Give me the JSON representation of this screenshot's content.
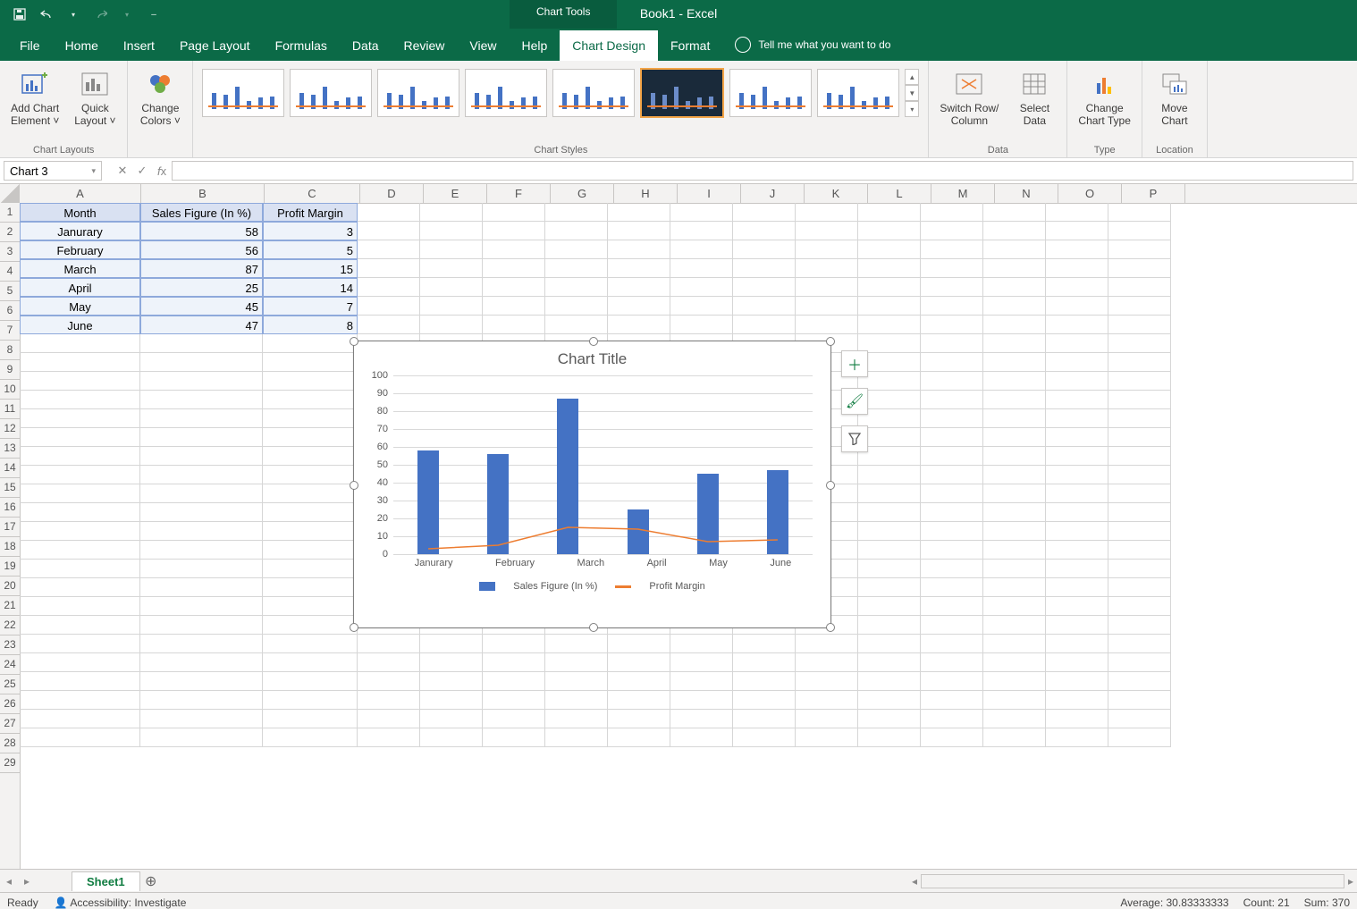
{
  "titlebar": {
    "doc": "Book1  -  Excel",
    "contextual": "Chart Tools"
  },
  "tabs": [
    "File",
    "Home",
    "Insert",
    "Page Layout",
    "Formulas",
    "Data",
    "Review",
    "View",
    "Help",
    "Chart Design",
    "Format"
  ],
  "active_tab": "Chart Design",
  "tellme": "Tell me what you want to do",
  "ribbon": {
    "chart_layouts": {
      "label": "Chart Layouts",
      "add": "Add Chart\nElement ˅",
      "quick": "Quick\nLayout ˅"
    },
    "colors": {
      "label": "",
      "btn": "Change\nColors ˅"
    },
    "styles": {
      "label": "Chart Styles"
    },
    "data": {
      "label": "Data",
      "switch": "Switch Row/\nColumn",
      "select": "Select\nData"
    },
    "type": {
      "label": "Type",
      "change": "Change\nChart Type"
    },
    "location": {
      "label": "Location",
      "move": "Move\nChart"
    }
  },
  "namebox": "Chart 3",
  "columns": [
    "A",
    "B",
    "C",
    "D",
    "E",
    "F",
    "G",
    "H",
    "I",
    "J",
    "K",
    "L",
    "M",
    "N",
    "O",
    "P"
  ],
  "headers": {
    "A": "Month",
    "B": "Sales Figure (In %)",
    "C": "Profit Margin"
  },
  "rows": [
    {
      "A": "Janurary",
      "B": 58,
      "C": 3
    },
    {
      "A": "February",
      "B": 56,
      "C": 5
    },
    {
      "A": "March",
      "B": 87,
      "C": 15
    },
    {
      "A": "April",
      "B": 25,
      "C": 14
    },
    {
      "A": "May",
      "B": 45,
      "C": 7
    },
    {
      "A": "June",
      "B": 47,
      "C": 8
    }
  ],
  "chart_data": {
    "type": "combo",
    "title": "Chart Title",
    "categories": [
      "Janurary",
      "February",
      "March",
      "April",
      "May",
      "June"
    ],
    "series": [
      {
        "name": "Sales Figure (In %)",
        "type": "bar",
        "values": [
          58,
          56,
          87,
          25,
          45,
          47
        ],
        "color": "#4472c4"
      },
      {
        "name": "Profit Margin",
        "type": "line",
        "values": [
          3,
          5,
          15,
          14,
          7,
          8
        ],
        "color": "#ed7d31"
      }
    ],
    "ylim": [
      0,
      100
    ],
    "ystep": 10,
    "xlabel": "",
    "ylabel": "",
    "grid": true,
    "legend": "bottom"
  },
  "sheet_tab": "Sheet1",
  "status": {
    "ready": "Ready",
    "acc": "Accessibility: Investigate",
    "avg": "Average: 30.83333333",
    "count": "Count: 21",
    "sum": "Sum: 370"
  }
}
